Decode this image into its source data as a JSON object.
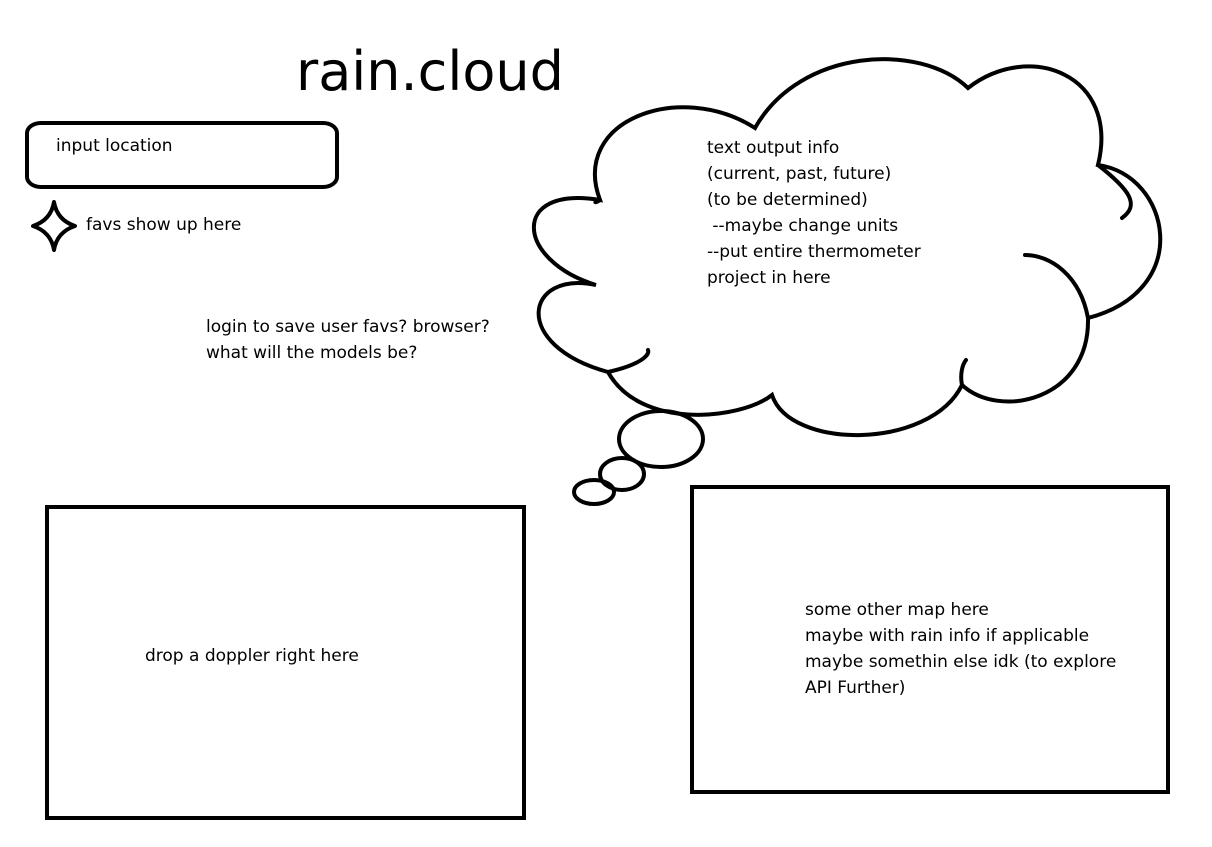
{
  "header": {
    "title": "rain.cloud"
  },
  "location": {
    "placeholder": "input location"
  },
  "favorites": {
    "icon": "star-icon",
    "label": "favs show up here"
  },
  "notes": {
    "text": "login to save user favs? browser?\nwhat will the models be?"
  },
  "weather_output": {
    "text": "text output info\n(current, past, future)\n(to be determined)\n --maybe change units\n--put entire thermometer\nproject in here"
  },
  "doppler_panel": {
    "text": "drop a doppler right here"
  },
  "map_panel": {
    "text": "some other map here\nmaybe with rain info if applicable\nmaybe somethin else idk (to explore\nAPI Further)"
  }
}
